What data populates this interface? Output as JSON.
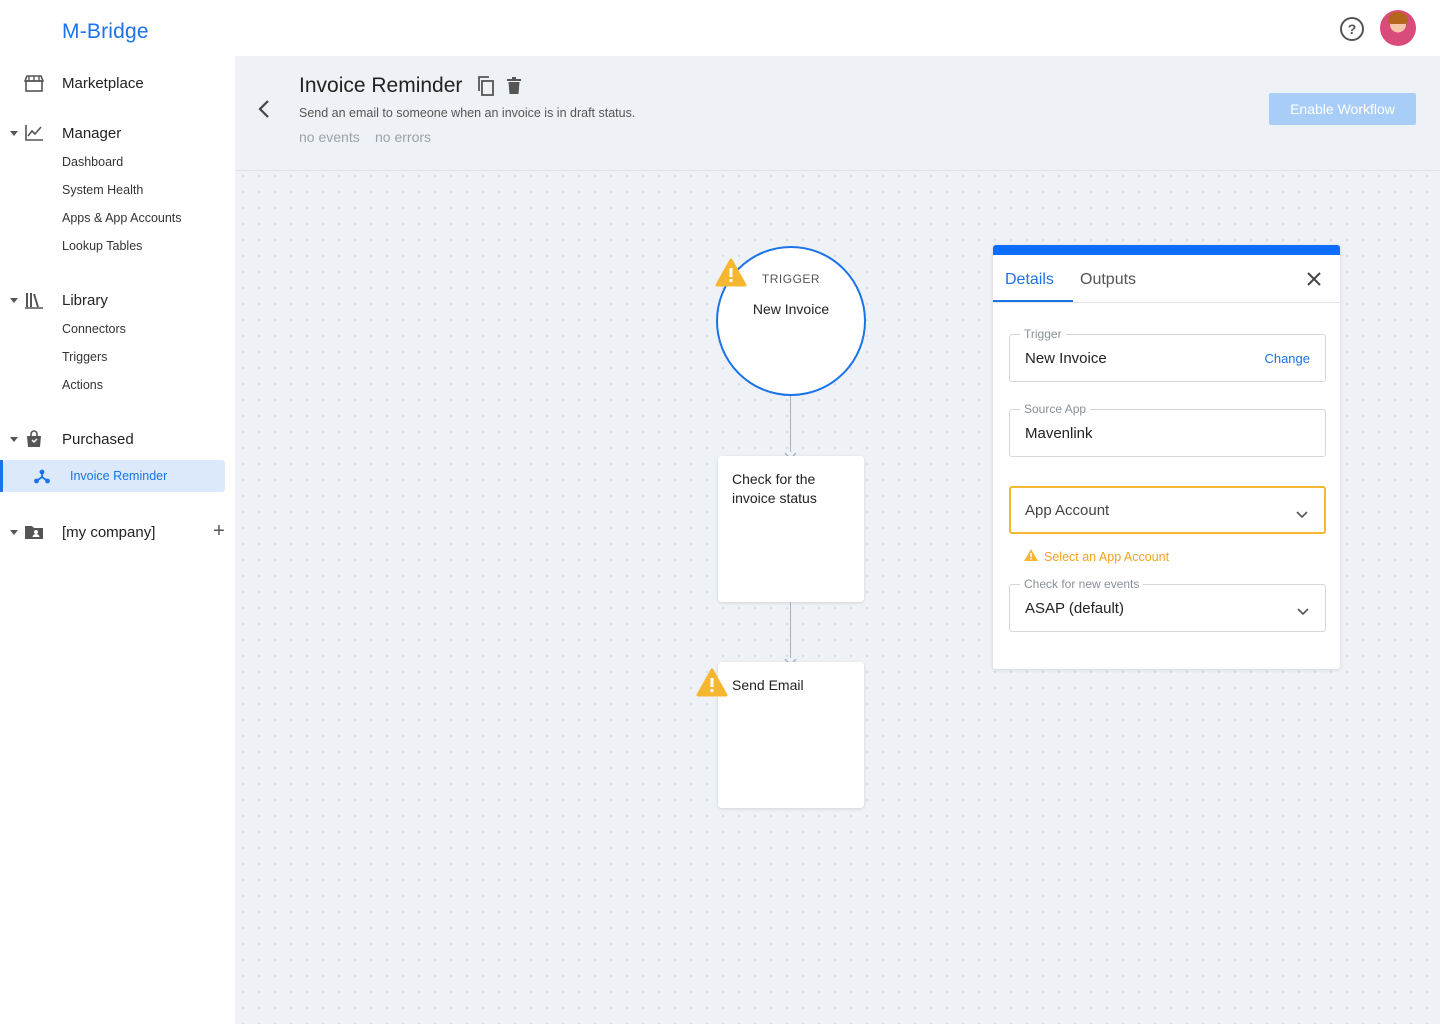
{
  "app": {
    "brand": "M-Bridge"
  },
  "topbar": {
    "help_icon": "question-circle-icon",
    "avatar_icon": "user-avatar"
  },
  "sidebar": {
    "sections": [
      {
        "label": "Marketplace",
        "icon": "store-icon"
      },
      {
        "label": "Manager",
        "icon": "chart-line-icon",
        "items": [
          "Dashboard",
          "System Health",
          "Apps & App Accounts",
          "Lookup Tables"
        ]
      },
      {
        "label": "Library",
        "icon": "books-icon",
        "items": [
          "Connectors",
          "Triggers",
          "Actions"
        ]
      },
      {
        "label": "Purchased",
        "icon": "shopping-bag-icon",
        "items": [
          "Invoice Reminder"
        ]
      },
      {
        "label": "[my company]",
        "icon": "folder-user-icon"
      }
    ],
    "active_item": "Invoice Reminder"
  },
  "workflow": {
    "title": "Invoice Reminder",
    "description": "Send an email to someone when an invoice is in draft status.",
    "events": "no events",
    "errors": "no errors",
    "enable_label": "Enable Workflow"
  },
  "flow": {
    "trigger": {
      "kind": "TRIGGER",
      "name": "New Invoice",
      "warning": true
    },
    "steps": [
      {
        "title": "Check for the invoice status",
        "warning": false
      },
      {
        "title": "Send Email",
        "warning": true
      }
    ]
  },
  "panel": {
    "tabs": [
      "Details",
      "Outputs"
    ],
    "active_tab": "Details",
    "fields": {
      "trigger": {
        "label": "Trigger",
        "value": "New Invoice",
        "action": "Change"
      },
      "source_app": {
        "label": "Source App",
        "value": "Mavenlink"
      },
      "app_account": {
        "placeholder": "App Account",
        "warning": "Select an App Account"
      },
      "check_events": {
        "label": "Check for new events",
        "value": "ASAP (default)"
      }
    }
  },
  "colors": {
    "accent": "#1a73e8",
    "warning": "#f5b731",
    "enable_disabled": "#a8cdf7"
  }
}
